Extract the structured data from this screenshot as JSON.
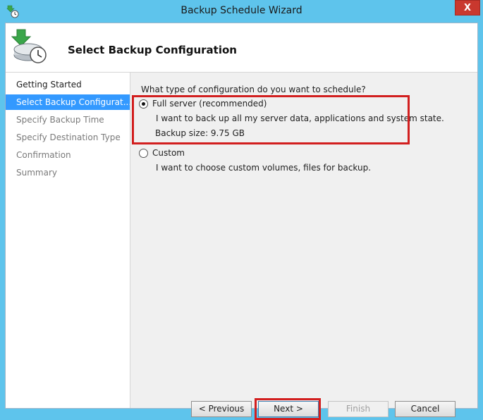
{
  "window": {
    "title": "Backup Schedule Wizard",
    "close_glyph": "X"
  },
  "header": {
    "title": "Select Backup Configuration",
    "icon": "backup-schedule-icon"
  },
  "steps": [
    {
      "label": "Getting Started",
      "state": "done"
    },
    {
      "label": "Select Backup Configurat...",
      "state": "active"
    },
    {
      "label": "Specify Backup Time",
      "state": "pending"
    },
    {
      "label": "Specify Destination Type",
      "state": "pending"
    },
    {
      "label": "Confirmation",
      "state": "pending"
    },
    {
      "label": "Summary",
      "state": "pending"
    }
  ],
  "main": {
    "question": "What type of configuration do you want to schedule?",
    "options": [
      {
        "label": "Full server (recommended)",
        "selected": true,
        "description": "I want to back up all my server data, applications and system state.",
        "detail": "Backup size: 9.75 GB"
      },
      {
        "label": "Custom",
        "selected": false,
        "description": "I want to choose custom volumes, files for backup."
      }
    ]
  },
  "buttons": {
    "previous": "< Previous",
    "next": "Next >",
    "finish": "Finish",
    "cancel": "Cancel"
  },
  "colors": {
    "title_bar": "#5ec4ec",
    "selection": "#3399ff",
    "highlight": "#d21f1f",
    "close": "#c9382e"
  }
}
